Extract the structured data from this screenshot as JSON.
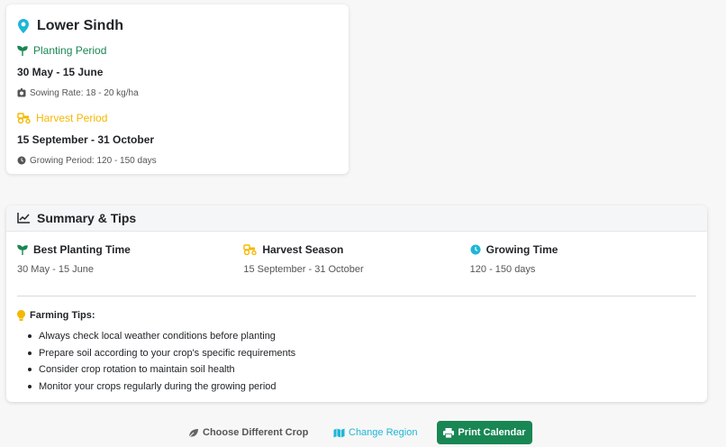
{
  "region": {
    "name": "Lower Sindh",
    "planting": {
      "label": "Planting Period",
      "dates": "30 May - 15 June",
      "sowing_rate": "Sowing Rate: 18 - 20 kg/ha"
    },
    "harvest": {
      "label": "Harvest Period",
      "dates": "15 September - 31 October",
      "growing_period": "Growing Period: 120 - 150 days"
    }
  },
  "summary": {
    "title": "Summary & Tips",
    "columns": [
      {
        "label": "Best Planting Time",
        "value": "30 May - 15 June"
      },
      {
        "label": "Harvest Season",
        "value": "15 September - 31 October"
      },
      {
        "label": "Growing Time",
        "value": "120 - 150 days"
      }
    ],
    "tips_title": "Farming Tips:",
    "tips": [
      "Always check local weather conditions before planting",
      "Prepare soil according to your crop's specific requirements",
      "Consider crop rotation to maintain soil health",
      "Monitor your crops regularly during the growing period"
    ]
  },
  "actions": {
    "choose_crop": "Choose Different Crop",
    "change_region": "Change Region",
    "print": "Print Calendar"
  },
  "colors": {
    "green": "#198754",
    "yellow": "#f5b800",
    "cyan": "#1fb6d6"
  }
}
